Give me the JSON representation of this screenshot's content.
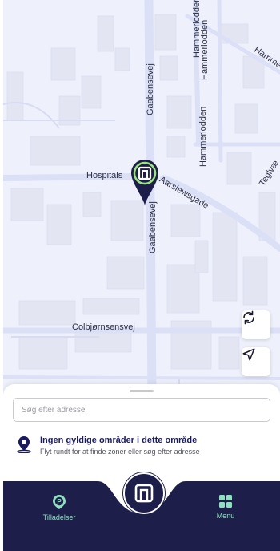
{
  "map": {
    "streets": {
      "hospitals": "Hospitals",
      "gaabensevej_top": "Gaabensevej",
      "gaabensevej_mid": "Gaabensevej",
      "hammerlodden_1": "Hammerlodden",
      "hammerlodden_2": "Hammerlodden",
      "hammerlodden_3": "Hammerlodden",
      "hamme_right": "Hamme",
      "aarslewsgade": "Aarslewsgade",
      "teglvaerk": "Teglvæ",
      "colbjornsensvej": "Colbjørnsensvej"
    },
    "controls": {
      "refresh_icon": "refresh-icon",
      "locate_icon": "navigation-arrow-icon"
    },
    "colors": {
      "map_bg": "#eef0fb",
      "road": "#dde1f5",
      "building": "#e4e6f3",
      "pin_dark": "#1d1e4a",
      "pin_accent": "#9be57a"
    }
  },
  "sheet": {
    "search_placeholder": "Søg efter adresse",
    "notice_title": "Ingen gyldige områder i dette område",
    "notice_subtitle": "Flyt rundt for at finde zoner eller søg efter adresse"
  },
  "nav": {
    "left_label": "Tilladelser",
    "right_label": "Menu",
    "colors": {
      "bar": "#1d1e4a",
      "accent": "#8ee0c0"
    }
  }
}
